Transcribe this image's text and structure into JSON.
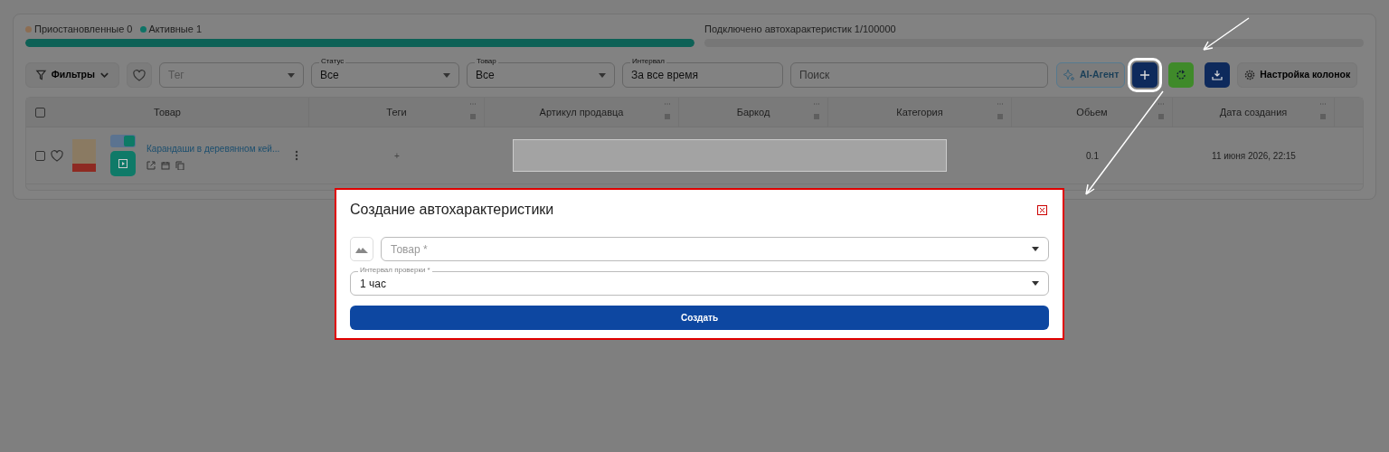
{
  "legend": [
    {
      "label": "Приостановленные 0",
      "color": "#8c6d52"
    },
    {
      "label": "Активные 1",
      "color": "#0e7366"
    }
  ],
  "status_progress": {
    "level": 1
  },
  "autochar_progress": {
    "label": "Подключено автохарактеристик 1/100000",
    "level": 0
  },
  "toolbar": {
    "filters": "Фильтры",
    "favorite": false,
    "tag": {
      "placeholder": "Тег"
    },
    "selects": [
      {
        "label": "Статус",
        "value": "Все"
      },
      {
        "label": "Товар",
        "value": "Все"
      }
    ],
    "interval": {
      "label": "Интервал",
      "value": "За все время"
    },
    "search": {
      "placeholder": "Поиск"
    },
    "ai_button": "AI-Агент",
    "columns_button": "Настройка колонок"
  },
  "table": {
    "all_checked": false,
    "columns": [
      "Товар",
      "Теги",
      "Артикул продавца",
      "Баркод",
      "Категория",
      "Обьем",
      "Дата создания"
    ],
    "rows": [
      {
        "checked": false,
        "favorite": false,
        "on": true,
        "product": "Карандаши в деревянном кей...",
        "tags": "+",
        "volume": "0.1",
        "created": "11 июня 2026, 22:15"
      }
    ]
  },
  "modal": {
    "title": "Создание автохарактеристики",
    "product": {
      "placeholder": "Товар *"
    },
    "interval": {
      "label": "Интервал проверки *",
      "value": "1 час"
    },
    "submit": "Создать"
  }
}
